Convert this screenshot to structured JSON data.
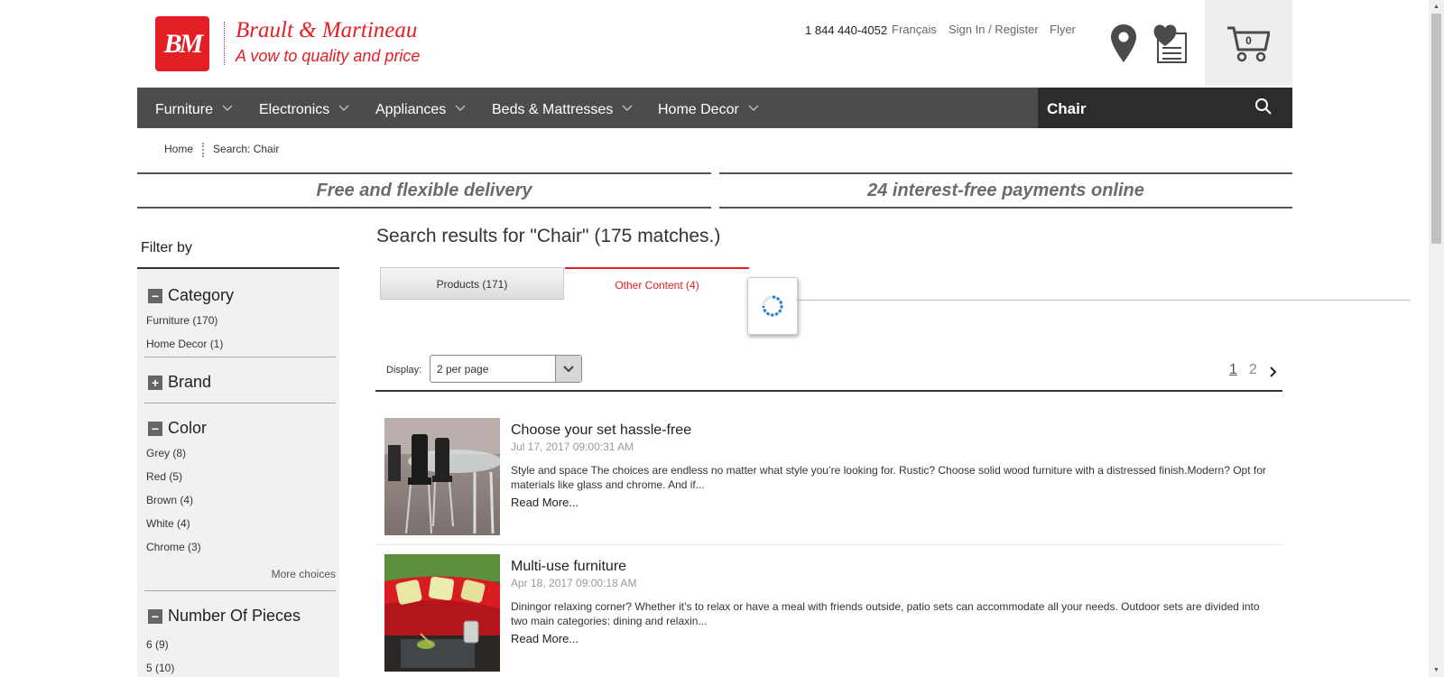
{
  "header": {
    "logo_text": "BM",
    "brand_name": "Brault & Martineau",
    "tagline": "A vow to quality and price",
    "phone": "1 844 440-4052",
    "links": [
      "Français",
      "Sign In / Register",
      "Flyer"
    ],
    "store_icon": "location-pin-icon",
    "wishlist_icon": "heart-list-icon",
    "cart_icon": "cart-icon",
    "cart_count": "0"
  },
  "nav": {
    "items": [
      "Furniture",
      "Electronics",
      "Appliances",
      "Beds & Mattresses",
      "Home Decor"
    ],
    "search_value": "Chair",
    "search_icon": "search-icon"
  },
  "breadcrumb": [
    "Home",
    "Search: Chair"
  ],
  "promos": [
    "Free and flexible delivery",
    "24 interest-free payments online"
  ],
  "sidebar": {
    "title": "Filter by",
    "facets": [
      {
        "name": "Category",
        "expanded": true,
        "options": [
          "Furniture (170)",
          "Home Decor (1)"
        ]
      },
      {
        "name": "Brand",
        "expanded": false,
        "options": []
      },
      {
        "name": "Color",
        "expanded": true,
        "options": [
          "Grey (8)",
          "Red (5)",
          "Brown (4)",
          "White (4)",
          "Chrome (3)"
        ],
        "more": "More choices"
      },
      {
        "name": "Number Of Pieces",
        "expanded": true,
        "options": [
          "6 (9)",
          "5 (10)"
        ]
      }
    ]
  },
  "main": {
    "results_title": "Search results for \"Chair\" (175 matches.)",
    "tabs": [
      {
        "label": "Products (171)",
        "active": false
      },
      {
        "label": "Other Content (4)",
        "active": true
      }
    ],
    "display_label": "Display:",
    "display_value": "2 per page",
    "pages": [
      "1",
      "2"
    ],
    "current_page": "1",
    "results": [
      {
        "title": "Choose your set hassle-free",
        "date": "Jul 17, 2017 09:00:31 AM",
        "description": "Style and space The choices are endless no matter what style you’re looking for. Rustic? Choose solid wood furniture with a distressed finish.Modern? Opt for materials like glass and chrome. And if...",
        "more": "Read More..."
      },
      {
        "title": "Multi-use furniture",
        "date": "Apr 18, 2017 09:00:18 AM",
        "description": "Diningor relaxing corner? Whether it’s to relax or have a meal with friends outside, patio sets can accommodate all your needs. Outdoor sets are divided into two main categories: dining and relaxin...",
        "more": "Read More..."
      }
    ]
  },
  "colors": {
    "brand_red": "#e31e24",
    "nav_bg": "#4c4d4b",
    "search_bg": "#2b2c2b",
    "panel_bg": "#f1f1ef"
  }
}
